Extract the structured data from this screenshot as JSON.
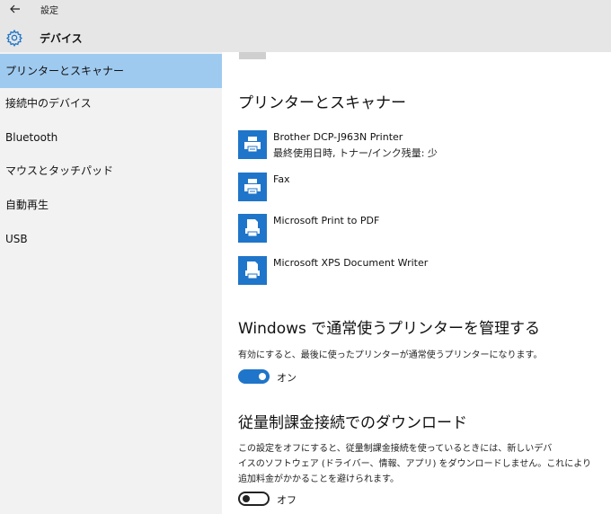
{
  "window": {
    "title": "設定"
  },
  "header": {
    "section": "デバイス"
  },
  "sidebar": {
    "items": [
      {
        "label": "プリンターとスキャナー",
        "active": true
      },
      {
        "label": "接続中のデバイス",
        "active": false
      },
      {
        "label": "Bluetooth",
        "active": false
      },
      {
        "label": "マウスとタッチパッド",
        "active": false
      },
      {
        "label": "自動再生",
        "active": false
      },
      {
        "label": "USB",
        "active": false
      }
    ]
  },
  "printers": {
    "heading": "プリンターとスキャナー",
    "items": [
      {
        "name": "Brother DCP-J963N Printer",
        "status": "最終使用日時, トナー/インク残量: 少",
        "icon": "printer-icon"
      },
      {
        "name": "Fax",
        "status": "",
        "icon": "fax-icon"
      },
      {
        "name": "Microsoft Print to PDF",
        "status": "",
        "icon": "document-printer-icon"
      },
      {
        "name": "Microsoft XPS Document Writer",
        "status": "",
        "icon": "document-printer-icon"
      }
    ]
  },
  "default_printer": {
    "heading": "Windows で通常使うプリンターを管理する",
    "description": "有効にすると、最後に使ったプリンターが通常使うプリンターになります。",
    "toggle_state": "on",
    "toggle_label": "オン"
  },
  "metered": {
    "heading": "従量制課金接続でのダウンロード",
    "description_lines": [
      "この設定をオフにすると、従量制課金接続を使っているときには、新しいデバ",
      "イスのソフトウェア (ドライバー、情報、アプリ) をダウンロードしません。これにより",
      "追加料金がかかることを避けられます。"
    ],
    "toggle_state": "off",
    "toggle_label": "オフ"
  },
  "colors": {
    "accent": "#1f75c9",
    "sidebar_active": "#9fcaf0",
    "titlebar": "#e6e6e6",
    "sidebar_bg": "#f2f2f2"
  }
}
